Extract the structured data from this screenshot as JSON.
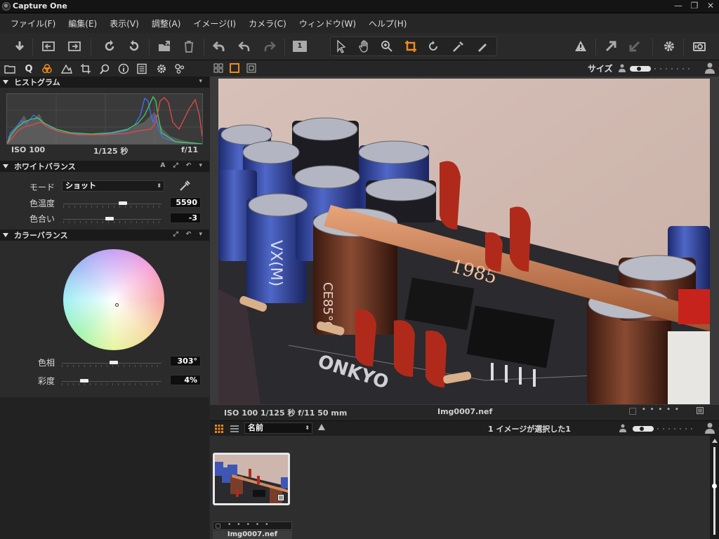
{
  "window": {
    "title": "Capture One"
  },
  "menubar": {
    "items": [
      "ファイル(F)",
      "編集(E)",
      "表示(V)",
      "調整(A)",
      "イメージ(I)",
      "カメラ(C)",
      "ウィンドウ(W)",
      "ヘルプ(H)"
    ]
  },
  "toolbar": {
    "counter_label": "1",
    "active_tool": "crop-tool",
    "accent_color": "#f08a1c"
  },
  "histogram": {
    "title": "ヒストグラム",
    "iso": "ISO 100",
    "shutter": "1/125 秒",
    "aperture": "f/11"
  },
  "white_balance": {
    "title": "ホワイトバランス",
    "mode_label": "モード",
    "mode_value": "ショット",
    "temp_label": "色温度",
    "temp_value": "5590",
    "temp_level": 0.62,
    "tint_label": "色合い",
    "tint_value": "-3",
    "tint_level": 0.47
  },
  "color_balance": {
    "title": "カラーバランス",
    "hue_label": "色相",
    "hue_value": "303°",
    "hue_level": 0.52,
    "sat_label": "彩度",
    "sat_value": "4%",
    "sat_level": 0.2
  },
  "viewer": {
    "size_label": "サイズ",
    "info": "ISO 100  1/125 秒  f/11  50 mm",
    "filename": "Img0007.nef"
  },
  "browser": {
    "sort_value": "名前",
    "selection_status": "1 イメージが選択した1",
    "thumbnail_name": "Img0007.nef"
  }
}
